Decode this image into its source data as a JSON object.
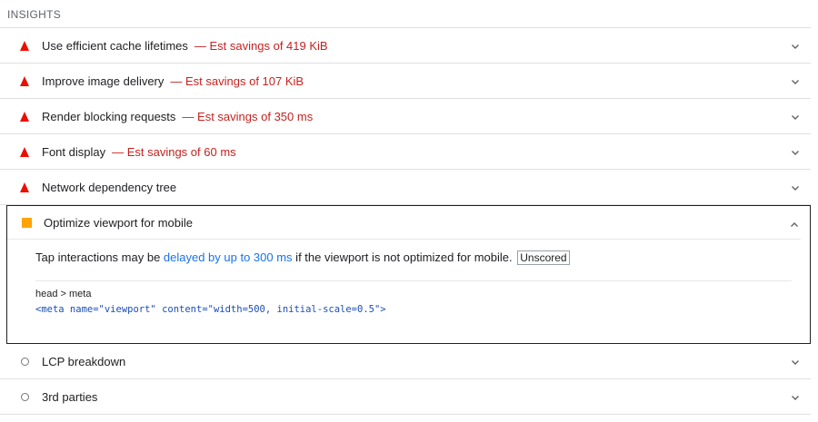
{
  "section": {
    "title": "INSIGHTS"
  },
  "audits": [
    {
      "title": "Use efficient cache lifetimes",
      "savings": "— Est savings of 419 KiB",
      "icon": "fail-triangle-icon"
    },
    {
      "title": "Improve image delivery",
      "savings": "— Est savings of 107 KiB",
      "icon": "fail-triangle-icon"
    },
    {
      "title": "Render blocking requests",
      "savings": "— Est savings of 350 ms",
      "icon": "fail-triangle-icon"
    },
    {
      "title": "Font display",
      "savings": "— Est savings of 60 ms",
      "icon": "fail-triangle-icon"
    },
    {
      "title": "Network dependency tree",
      "savings": "",
      "icon": "fail-triangle-icon"
    }
  ],
  "expanded": {
    "title": "Optimize viewport for mobile",
    "icon": "average-square-icon",
    "desc_before": "Tap interactions may be ",
    "desc_link": "delayed by up to 300 ms",
    "desc_after": " if the viewport is not optimized for mobile.",
    "badge": "Unscored",
    "selector": "head > meta",
    "snippet": "<meta name=\"viewport\" content=\"width=500, initial-scale=0.5\">"
  },
  "passed": [
    {
      "title": "LCP breakdown",
      "icon": "info-circle-icon"
    },
    {
      "title": "3rd parties",
      "icon": "info-circle-icon"
    }
  ],
  "colors": {
    "fail": "#eb0f00",
    "average": "#ffa400",
    "savings_text": "#c5221f",
    "link": "#1a73e8"
  }
}
